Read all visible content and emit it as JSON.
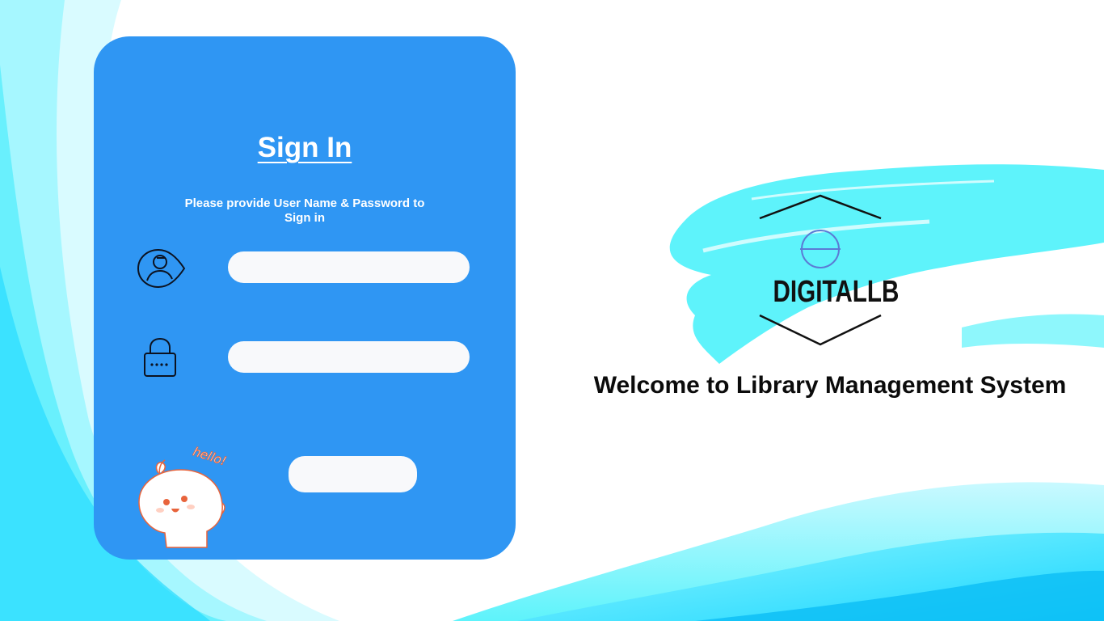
{
  "signin": {
    "title": "Sign In",
    "subtitle": "Please provide User Name & Password to Sign in",
    "username": {
      "value": "",
      "placeholder": ""
    },
    "password": {
      "value": "",
      "placeholder": ""
    },
    "submit_label": ""
  },
  "mascot": {
    "speech": "hello!"
  },
  "branding": {
    "logo_text": "DIGITALLB",
    "welcome": "Welcome to Library Management System"
  },
  "colors": {
    "card": "#2f96f3",
    "accent": "#5ef3fb",
    "field": "#f8f9fb"
  },
  "icons": [
    "user-icon",
    "lock-icon",
    "logo-globe-icon"
  ]
}
